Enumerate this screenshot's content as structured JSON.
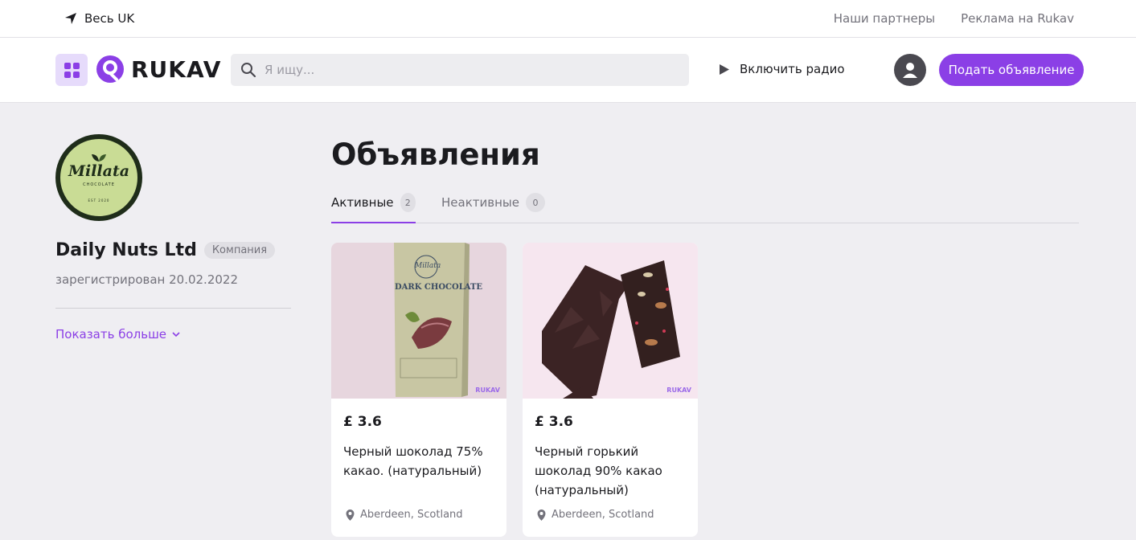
{
  "topbar": {
    "location": "Весь UK",
    "links": [
      "Наши партнеры",
      "Реклама на Rukav"
    ]
  },
  "header": {
    "logo_text": "RUKAV",
    "search_placeholder": "Я ищу...",
    "radio_label": "Включить радио",
    "post_button": "Подать объявление"
  },
  "profile": {
    "logo_brand": "Millata",
    "logo_sub": "CHOCOLATE",
    "logo_est": "EST 2020",
    "name": "Daily Nuts Ltd",
    "badge": "Компания",
    "registered": "зарегистрирован 20.02.2022",
    "show_more": "Показать больше"
  },
  "listings": {
    "title": "Объявления",
    "tabs": [
      {
        "label": "Активные",
        "count": "2"
      },
      {
        "label": "Неактивные",
        "count": "0"
      }
    ],
    "items": [
      {
        "price": "£ 3.6",
        "title": "Черный шоколад 75% какао. (натуральный)",
        "location": "Aberdeen, Scotland",
        "package_title": "DARK CHOCOLATE",
        "package_brand": "Millata"
      },
      {
        "price": "£ 3.6",
        "title": "Черный горький шоколад 90% какао (натуральный)",
        "location": "Aberdeen, Scotland"
      }
    ]
  },
  "watermark": "RUKAV",
  "colors": {
    "accent": "#8b3fe6",
    "accent_light": "#e6dbfb",
    "page_bg": "#efeef2",
    "text": "#1b1b1f",
    "muted": "#73727b"
  }
}
